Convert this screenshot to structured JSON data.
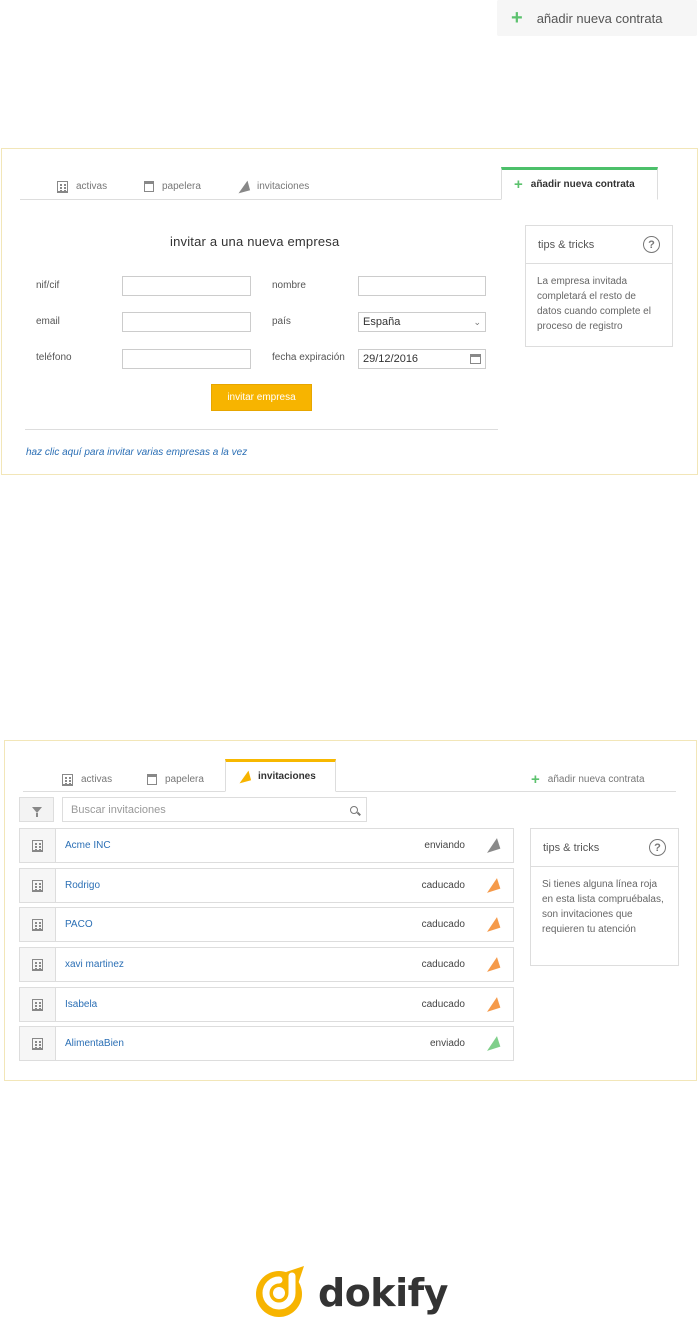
{
  "top_button": {
    "label": "añadir nueva contrata",
    "icon": "plus-icon"
  },
  "form_panel": {
    "tabs": [
      {
        "label": "activas",
        "icon": "building-icon"
      },
      {
        "label": "papelera",
        "icon": "trash-icon"
      },
      {
        "label": "invitaciones",
        "icon": "paper-plane-icon"
      },
      {
        "label": "añadir nueva contrata",
        "icon": "plus-icon",
        "active": true
      }
    ],
    "title": "invitar a una nueva empresa",
    "fields": {
      "nif_label": "nif/cif",
      "nif_value": "",
      "nombre_label": "nombre",
      "nombre_value": "",
      "email_label": "email",
      "email_value": "",
      "pais_label": "país",
      "pais_value": "España",
      "telefono_label": "teléfono",
      "telefono_value": "",
      "fecha_label": "fecha expiración",
      "fecha_value": "29/12/2016"
    },
    "submit_label": "invitar empresa",
    "multi_link": "haz clic aquí para invitar varias empresas a la vez",
    "tips": {
      "title": "tips & tricks",
      "body": "La empresa invitada completará el resto de datos cuando complete el proceso de registro"
    }
  },
  "list_panel": {
    "tabs": [
      {
        "label": "activas",
        "icon": "building-icon"
      },
      {
        "label": "papelera",
        "icon": "trash-icon"
      },
      {
        "label": "invitaciones",
        "icon": "paper-plane-icon",
        "active": true
      },
      {
        "label": "añadir nueva contrata",
        "icon": "plus-icon"
      }
    ],
    "search_placeholder": "Buscar invitaciones",
    "rows": [
      {
        "name": "Acme INC",
        "status": "enviando",
        "plane_color": "#8a8a8a"
      },
      {
        "name": "Rodrigo",
        "status": "caducado",
        "plane_color": "#f59a4a"
      },
      {
        "name": "PACO",
        "status": "caducado",
        "plane_color": "#f59a4a"
      },
      {
        "name": "xavi martinez",
        "status": "caducado",
        "plane_color": "#f59a4a"
      },
      {
        "name": "Isabela",
        "status": "caducado",
        "plane_color": "#f59a4a"
      },
      {
        "name": "AlimentaBien",
        "status": "enviado",
        "plane_color": "#7fcf8a"
      }
    ],
    "tips": {
      "title": "tips & tricks",
      "body": "Si tienes alguna línea roja en esta lista compruébalas, son invitaciones que requieren tu atención"
    }
  },
  "brand": {
    "name": "dokify",
    "accent": "#f7b400"
  }
}
